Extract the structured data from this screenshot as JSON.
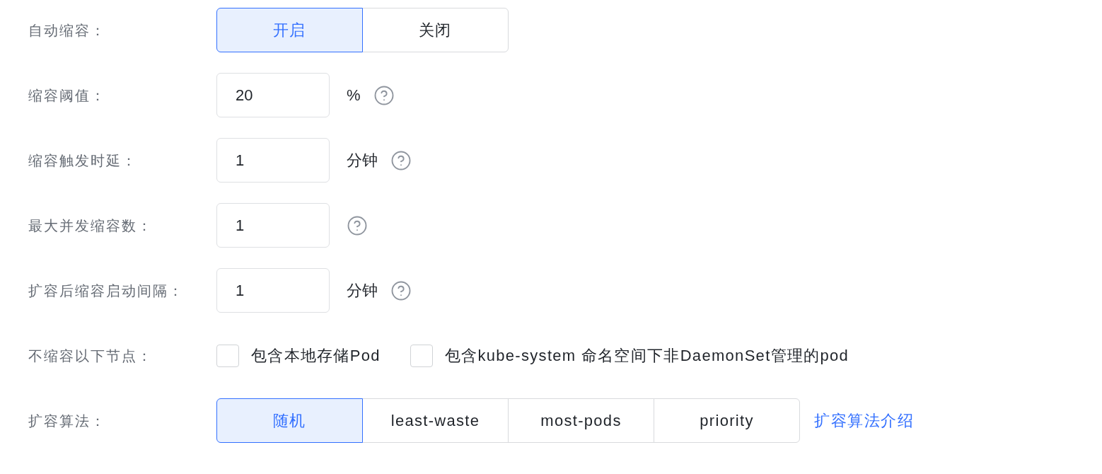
{
  "rows": [
    {
      "kind": "segmented",
      "label": "自动缩容：",
      "options": [
        {
          "label": "开启",
          "selected": true
        },
        {
          "label": "关闭",
          "selected": false
        }
      ]
    },
    {
      "kind": "number",
      "label": "缩容阈值：",
      "value": "20",
      "unit": "%",
      "help": true
    },
    {
      "kind": "number",
      "label": "缩容触发时延：",
      "value": "1",
      "unit": "分钟",
      "help": true
    },
    {
      "kind": "number",
      "label": "最大并发缩容数：",
      "value": "1",
      "help": true
    },
    {
      "kind": "number",
      "label": "扩容后缩容启动间隔：",
      "value": "1",
      "unit": "分钟",
      "help": true
    },
    {
      "kind": "checkboxes",
      "label": "不缩容以下节点：",
      "options": [
        {
          "label": "包含本地存储Pod",
          "checked": false
        },
        {
          "label": "包含kube-system 命名空间下非DaemonSet管理的pod",
          "checked": false
        }
      ]
    },
    {
      "kind": "segmented",
      "label": "扩容算法：",
      "options": [
        {
          "label": "随机",
          "selected": true
        },
        {
          "label": "least-waste",
          "selected": false
        },
        {
          "label": "most-pods",
          "selected": false
        },
        {
          "label": "priority",
          "selected": false
        }
      ],
      "link": "扩容算法介绍"
    }
  ]
}
